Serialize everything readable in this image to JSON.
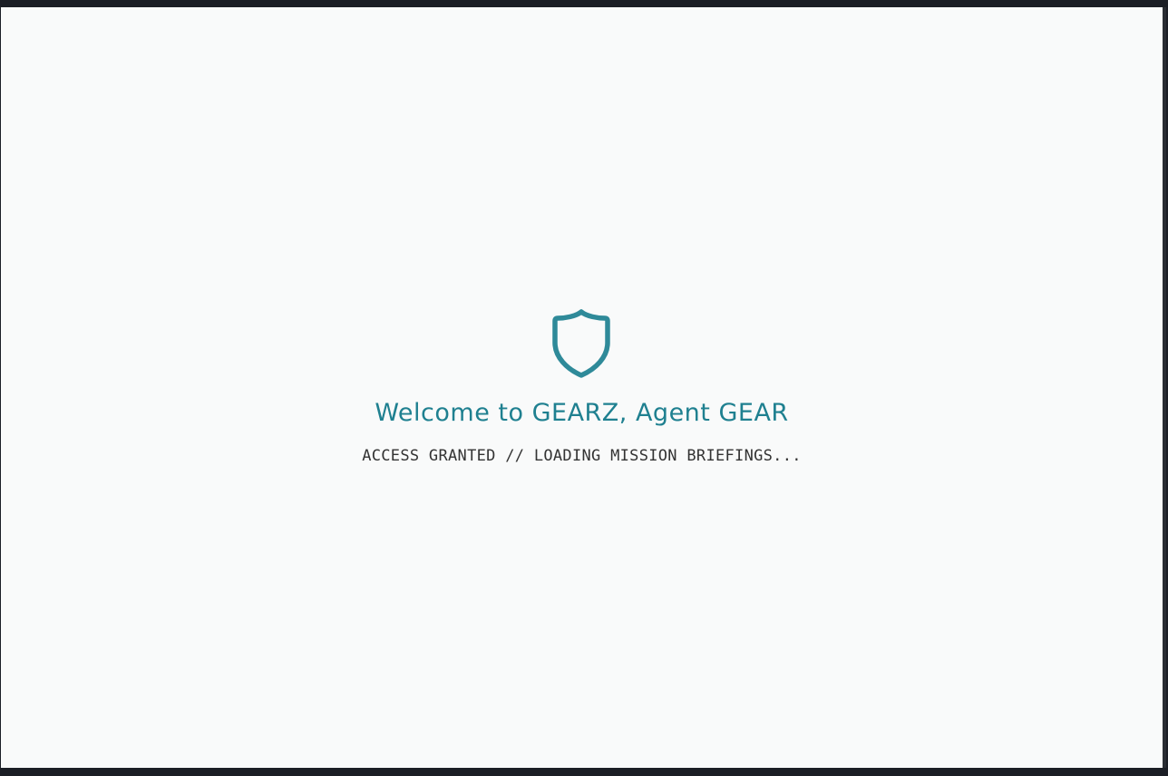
{
  "splash": {
    "icon": "shield-icon",
    "title": "Welcome to GEARZ, Agent GEAR",
    "status": "ACCESS GRANTED // LOADING MISSION BRIEFINGS..."
  },
  "colors": {
    "accent": "#2f8a99",
    "title": "#1f8090",
    "status_text": "#333333",
    "background": "#f9fafa",
    "frame": "#1b1e25"
  }
}
